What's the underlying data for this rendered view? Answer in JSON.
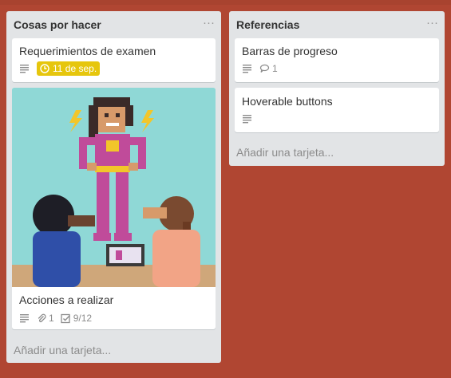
{
  "lists": [
    {
      "title": "Cosas por hacer",
      "menu": "···",
      "cards": [
        {
          "title": "Requerimientos de examen",
          "due": "11 de sep."
        },
        {
          "title": "Acciones a realizar",
          "attachments": "1",
          "checklist": "9/12"
        }
      ],
      "add_card": "Añadir una tarjeta..."
    },
    {
      "title": "Referencias",
      "menu": "···",
      "cards": [
        {
          "title": "Barras de progreso",
          "comments": "1"
        },
        {
          "title": "Hoverable buttons"
        }
      ],
      "add_card": "Añadir una tarjeta..."
    }
  ],
  "colors": {
    "board_background": "#b04632",
    "list_background": "#e2e4e6",
    "due_badge": "#e6c60d",
    "cover_background": "#8fd8d6"
  },
  "icons": [
    "description-icon",
    "clock-icon",
    "comment-icon",
    "attachment-icon",
    "checklist-icon",
    "menu-dots-icon"
  ]
}
